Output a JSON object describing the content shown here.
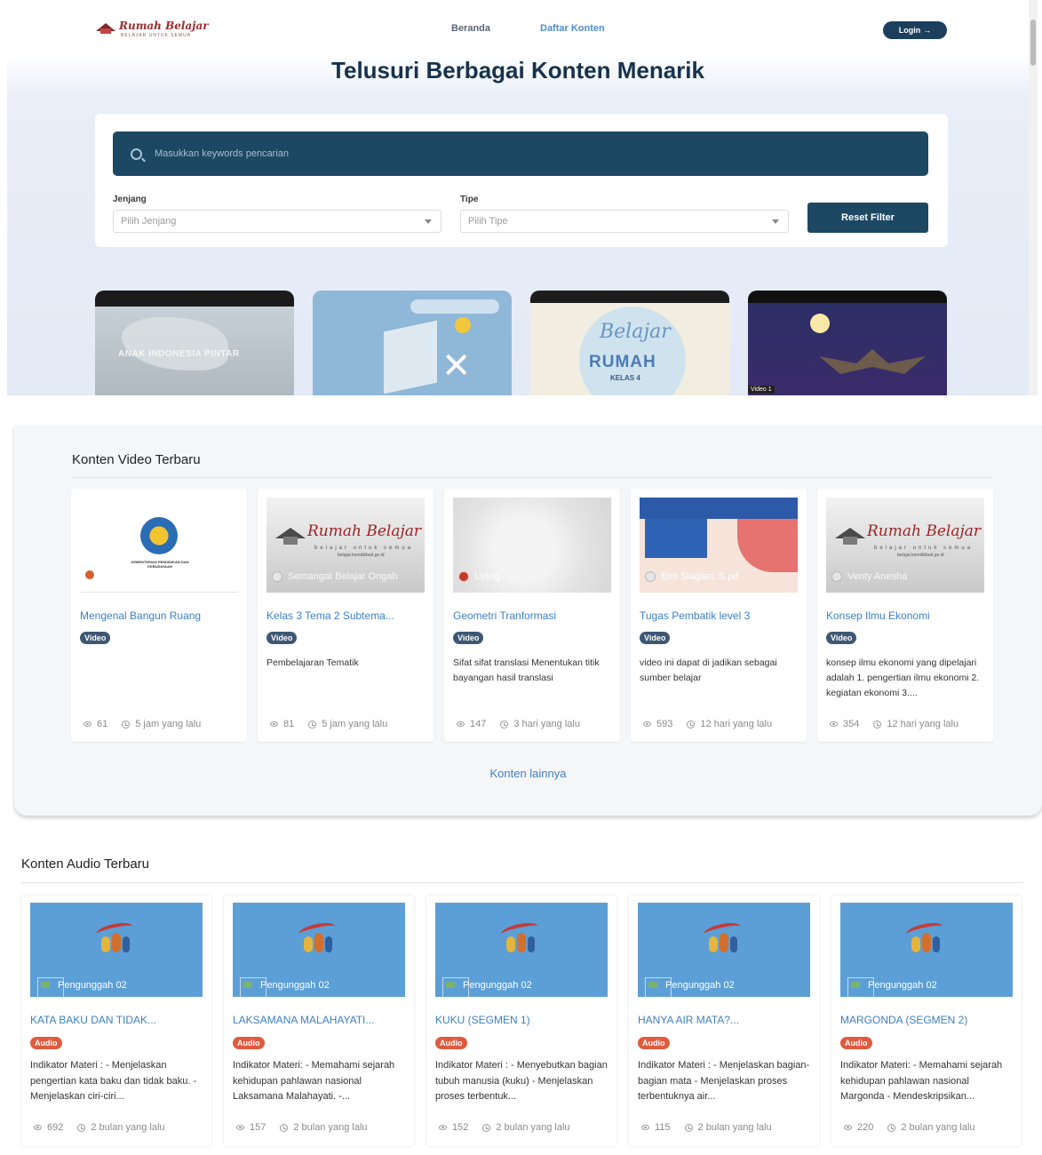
{
  "header": {
    "logo_text": "Rumah Belajar",
    "logo_sub": "BELAJAR UNTUK SEMUA",
    "nav": [
      {
        "label": "Beranda",
        "active": false
      },
      {
        "label": "Daftar Konten",
        "active": true
      }
    ],
    "login_label": "Login"
  },
  "hero": {
    "title": "Telusuri Berbagai Konten Menarik"
  },
  "filter": {
    "search_placeholder": "Masukkan keywords pencarian",
    "jenjang_label": "Jenjang",
    "jenjang_value": "Pilih Jenjang",
    "tipe_label": "Tipe",
    "tipe_value": "Pilih Tipe",
    "reset_label": "Reset Filter"
  },
  "featured": {
    "thumb1_text": "ANAK INDONESIA PINTAR",
    "thumb3_title": "Belajar",
    "thumb3_brand": "RUMAH",
    "thumb3_class": "KELAS 4",
    "thumb4_label": "Video 1"
  },
  "video_section": {
    "title": "Konten Video Terbaru",
    "more_label": "Konten lainnya",
    "items": [
      {
        "title": "Mengenal Bangun Ruang",
        "badge": "Video",
        "uploader": "",
        "desc": "",
        "views": "61",
        "time": "5 jam yang lalu"
      },
      {
        "title": "Kelas 3 Tema 2 Subtema...",
        "badge": "Video",
        "uploader": "Semangat Belajar Ongah",
        "desc": "Pembelajaran Tematik",
        "views": "81",
        "time": "5 jam yang lalu"
      },
      {
        "title": "Geometri Tranformasi",
        "badge": "Video",
        "uploader": "Ujang",
        "desc": "Sifat sifat translasi Menentukan titik bayangan hasil translasi",
        "views": "147",
        "time": "3 hari yang lalu"
      },
      {
        "title": "Tugas Pembatik level 3",
        "badge": "Video",
        "uploader": "Emi Siagian, S.pd",
        "desc": "video ini dapat di jadikan sebagai sumber belajar",
        "views": "593",
        "time": "12 hari yang lalu"
      },
      {
        "title": "Konsep Ilmu Ekonomi",
        "badge": "Video",
        "uploader": "Venty Anesha",
        "desc": "konsep ilmu ekonomi yang dipelajari adalah 1. pengertian ilmu ekonomi 2. kegiatan ekonomi 3....",
        "views": "354",
        "time": "12 hari yang lalu"
      }
    ],
    "rb_title": "Rumah Belajar",
    "rb_sub": "belajar untuk semua",
    "rb_url": "belajar.kemdikbud.go.id",
    "kemdik_text": "KEMENTERIAN PENDIDIKAN DAN KEBUDAYAAN"
  },
  "audio_section": {
    "title": "Konten Audio Terbaru",
    "items": [
      {
        "title": "KATA BAKU DAN TIDAK...",
        "badge": "Audio",
        "uploader": "Pengunggah 02",
        "desc": "Indikator Materi : - Menjelaskan pengertian kata baku dan tidak baku. - Menjelaskan ciri-ciri...",
        "views": "692",
        "time": "2 bulan yang lalu"
      },
      {
        "title": "LAKSAMANA MALAHAYATI...",
        "badge": "Audio",
        "uploader": "Pengunggah 02",
        "desc": "Indikator Materi: - Memahami sejarah kehidupan pahlawan nasional Laksamana Malahayati. -...",
        "views": "157",
        "time": "2 bulan yang lalu"
      },
      {
        "title": "KUKU (SEGMEN 1)",
        "badge": "Audio",
        "uploader": "Pengunggah 02",
        "desc": "Indikator Materi : - Menyebutkan bagian tubuh manusia (kuku) - Menjelaskan proses terbentuk...",
        "views": "152",
        "time": "2 bulan yang lalu"
      },
      {
        "title": "HANYA AIR MATA?...",
        "badge": "Audio",
        "uploader": "Pengunggah 02",
        "desc": "Indikator Materi : - Menjelaskan bagian-bagian mata - Menjelaskan proses terbentuknya air...",
        "views": "115",
        "time": "2 bulan yang lalu"
      },
      {
        "title": "MARGONDA (SEGMEN 2)",
        "badge": "Audio",
        "uploader": "Pengunggah 02",
        "desc": "Indikator Materi: - Memahami sejarah kehidupan pahlawan nasional Margonda - Mendeskripsikan...",
        "views": "220",
        "time": "2 bulan yang lalu"
      }
    ]
  },
  "colors": {
    "primary_dark": "#1c4863",
    "link_blue": "#3f7fc2",
    "video_badge": "#3e5874",
    "audio_badge": "#e05b3e",
    "audio_thumb": "#5b9fd6"
  }
}
